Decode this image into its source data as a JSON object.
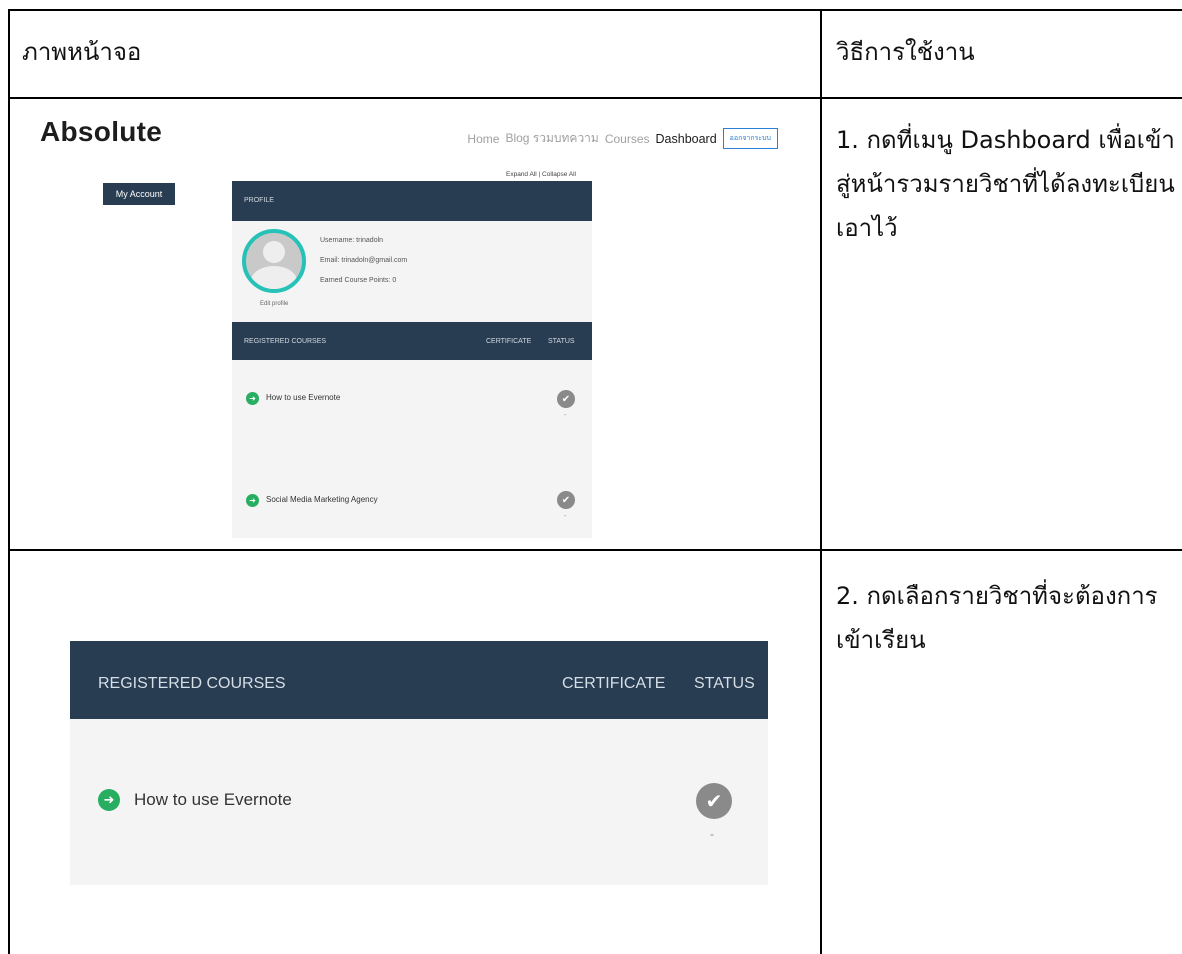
{
  "table": {
    "header_screen": "ภาพหน้าจอ",
    "header_howto": "วิธีการใช้งาน"
  },
  "rows": [
    {
      "instruction": "1. กดที่เมนู Dashboard เพื่อเข้าสู่หน้ารวมรายวิชาที่ได้ลงทะเบียนเอาไว้"
    },
    {
      "instruction": "2. กดเลือกรายวิชาที่จะต้องการเข้าเรียน"
    }
  ],
  "screenshot1": {
    "logo": "Absolute",
    "nav": [
      "Home",
      "Blog รวมบทความ",
      "Courses",
      "Dashboard"
    ],
    "nav_button": "ออกจากระบบ",
    "my_account": "My Account",
    "expand_collapse": "Expand All | Collapse All",
    "profile_label": "PROFILE",
    "username": "Username: trinadoln",
    "email": "Email: trinadoln@gmail.com",
    "points": "Earned Course Points: 0",
    "edit_profile": "Edit profile",
    "registered_label": "REGISTERED COURSES",
    "certificate_label": "CERTIFICATE",
    "status_label": "STATUS",
    "courses": [
      "How to use Evernote",
      "Social Media Marketing Agency"
    ],
    "dash": "-"
  },
  "screenshot2": {
    "registered_label": "REGISTERED COURSES",
    "certificate_label": "CERTIFICATE",
    "status_label": "STATUS",
    "course": "How to use Evernote",
    "dash": "-"
  },
  "icons": {
    "arrow": "➜",
    "check": "✔"
  },
  "colors": {
    "header_bar": "#283c52",
    "arrow_green": "#27ae60",
    "avatar_ring": "#26c2b8",
    "check_gray": "#8a8a8a"
  }
}
